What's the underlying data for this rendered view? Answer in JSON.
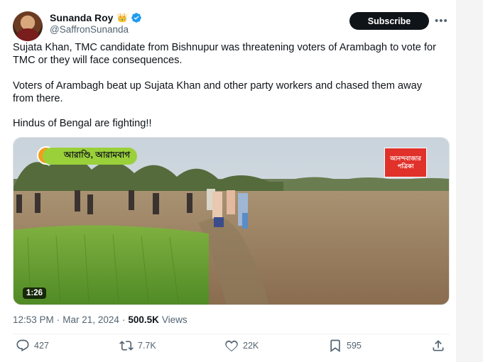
{
  "author": {
    "name": "Sunanda Roy",
    "name_emoji": "👑",
    "handle": "@SaffronSunanda"
  },
  "header": {
    "subscribe_label": "Subscribe",
    "more_label": "•••"
  },
  "tweet": {
    "paragraphs": [
      "Sujata Khan, TMC candidate from Bishnupur was threatening voters of Arambagh to vote for TMC or they will face consequences.",
      "Voters of Arambagh beat up Sujata Khan and other party workers and chased them away from there.",
      "Hindus of Bengal are fighting!!"
    ]
  },
  "media": {
    "overlay_text": "আরাণ্ডি, আরামবাগ",
    "source_logo_line1": "আনন্দবাজার",
    "source_logo_line2": "পত্রিকা",
    "duration": "1:26"
  },
  "meta": {
    "time": "12:53 PM",
    "separator": "·",
    "date": "Mar 21, 2024",
    "views_count": "500.5K",
    "views_label": "Views"
  },
  "actions": {
    "replies": "427",
    "reposts": "7.7K",
    "likes": "22K",
    "bookmarks": "595"
  },
  "colors": {
    "verified": "#1d9bf0",
    "text_primary": "#0f1419",
    "text_secondary": "#536471",
    "overlay_badge": "#9ad03a",
    "source_logo": "#e0312a"
  }
}
